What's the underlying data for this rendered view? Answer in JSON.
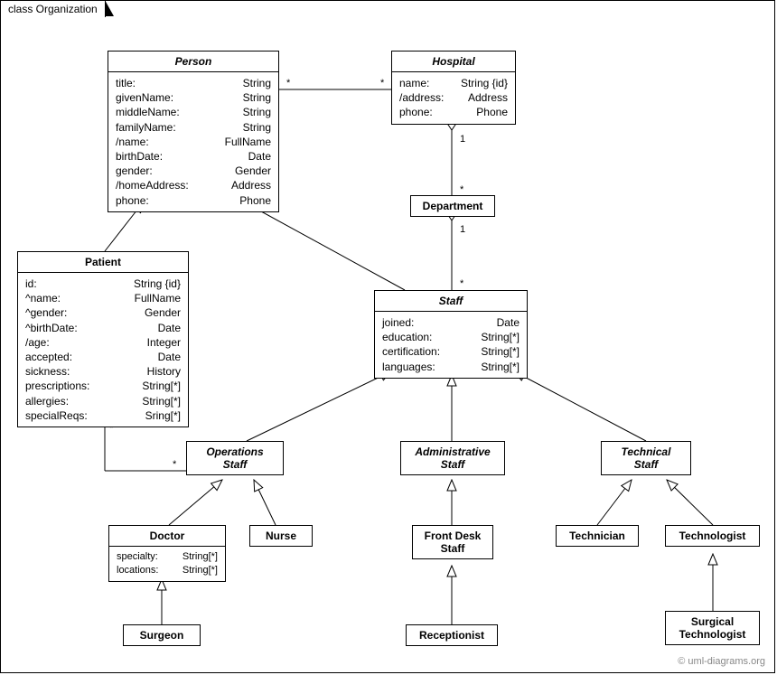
{
  "frame": {
    "label": "class Organization"
  },
  "credit": "© uml-diagrams.org",
  "classes": {
    "person": {
      "name": "Person",
      "attrs": [
        {
          "n": "title:",
          "t": "String"
        },
        {
          "n": "givenName:",
          "t": "String"
        },
        {
          "n": "middleName:",
          "t": "String"
        },
        {
          "n": "familyName:",
          "t": "String"
        },
        {
          "n": "/name:",
          "t": "FullName"
        },
        {
          "n": "birthDate:",
          "t": "Date"
        },
        {
          "n": "gender:",
          "t": "Gender"
        },
        {
          "n": "/homeAddress:",
          "t": "Address"
        },
        {
          "n": "phone:",
          "t": "Phone"
        }
      ]
    },
    "hospital": {
      "name": "Hospital",
      "attrs": [
        {
          "n": "name:",
          "t": "String {id}"
        },
        {
          "n": "/address:",
          "t": "Address"
        },
        {
          "n": "phone:",
          "t": "Phone"
        }
      ]
    },
    "department": {
      "name": "Department"
    },
    "patient": {
      "name": "Patient",
      "attrs": [
        {
          "n": "id:",
          "t": "String {id}"
        },
        {
          "n": "^name:",
          "t": "FullName"
        },
        {
          "n": "^gender:",
          "t": "Gender"
        },
        {
          "n": "^birthDate:",
          "t": "Date"
        },
        {
          "n": "/age:",
          "t": "Integer"
        },
        {
          "n": "accepted:",
          "t": "Date"
        },
        {
          "n": "sickness:",
          "t": "History"
        },
        {
          "n": "prescriptions:",
          "t": "String[*]"
        },
        {
          "n": "allergies:",
          "t": "String[*]"
        },
        {
          "n": "specialReqs:",
          "t": "Sring[*]"
        }
      ]
    },
    "staff": {
      "name": "Staff",
      "attrs": [
        {
          "n": "joined:",
          "t": "Date"
        },
        {
          "n": "education:",
          "t": "String[*]"
        },
        {
          "n": "certification:",
          "t": "String[*]"
        },
        {
          "n": "languages:",
          "t": "String[*]"
        }
      ]
    },
    "opsStaff": {
      "name": "Operations",
      "name2": "Staff"
    },
    "adminStaff": {
      "name": "Administrative",
      "name2": "Staff"
    },
    "techStaff": {
      "name": "Technical",
      "name2": "Staff"
    },
    "doctor": {
      "name": "Doctor",
      "attrs": [
        {
          "n": "specialty:",
          "t": "String[*]"
        },
        {
          "n": "locations:",
          "t": "String[*]"
        }
      ]
    },
    "nurse": {
      "name": "Nurse"
    },
    "frontDesk": {
      "name": "Front Desk",
      "name2": "Staff"
    },
    "technician": {
      "name": "Technician"
    },
    "technologist": {
      "name": "Technologist"
    },
    "surgeon": {
      "name": "Surgeon"
    },
    "receptionist": {
      "name": "Receptionist"
    },
    "surgTech": {
      "name": "Surgical",
      "name2": "Technologist"
    }
  },
  "mult": {
    "personHospital_l": "*",
    "personHospital_r": "*",
    "hospitalDept": "1",
    "deptTop": "*",
    "deptStaff_d": "1",
    "deptStaff_s": "*",
    "patientOps_p": "*",
    "patientOps_o": "*"
  }
}
